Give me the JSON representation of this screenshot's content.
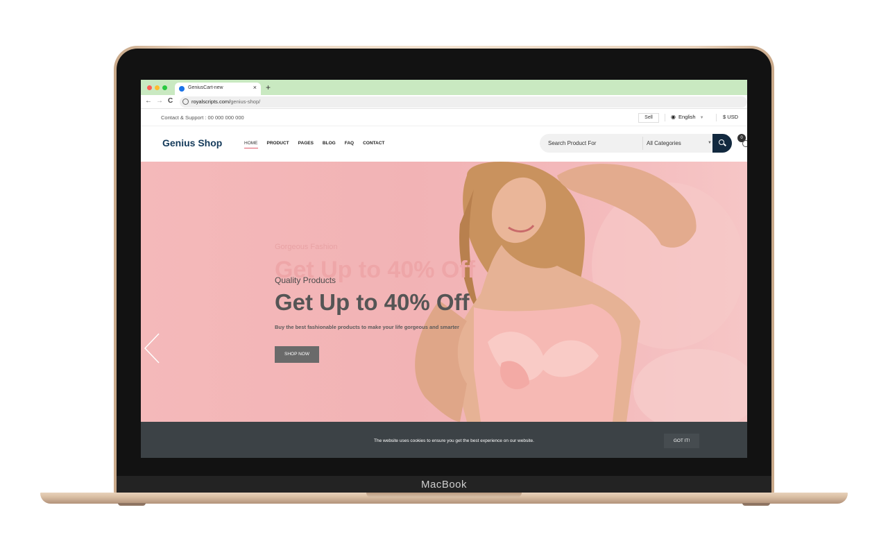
{
  "device": {
    "brand": "MacBook"
  },
  "browser": {
    "tab_title": "GeniusCart-new",
    "tab_close": "×",
    "new_tab": "+",
    "url_host": "royalscripts.com/",
    "url_path": "genius-shop/",
    "nav_back": "←",
    "nav_forward": "→",
    "nav_reload": "C"
  },
  "topbar": {
    "contact": "Contact & Support : 00 000 000 000",
    "sell": "Sell",
    "language": "English",
    "currency": "$  USD"
  },
  "header": {
    "logo": "Genius Shop",
    "nav": [
      "HOME",
      "PRODUCT",
      "PAGES",
      "BLOG",
      "FAQ",
      "CONTACT"
    ],
    "search_placeholder": "Search Product For",
    "category": "All Categories",
    "cart_count": "0"
  },
  "hero": {
    "ghost_subtitle": "Gorgeous Fashion",
    "ghost_title": "Get Up to 40% Off",
    "subtitle": "Quality Products",
    "title": "Get Up to 40% Off",
    "description": "Buy the best fashionable products to make your life gorgeous and smarter",
    "button": "SHOP NOW"
  },
  "cookie": {
    "text": "The website uses cookies to ensure you get the best experience on our website.",
    "button": "GOT IT!"
  },
  "colors": {
    "hero_bg": "#f4b9ba",
    "logo": "#143a5a",
    "search_button": "#12293f",
    "cookie_bar": "#3c4246"
  },
  "icons": [
    "globe-icon",
    "search-icon",
    "cart-icon",
    "chevron-left-icon",
    "lock-icon"
  ]
}
